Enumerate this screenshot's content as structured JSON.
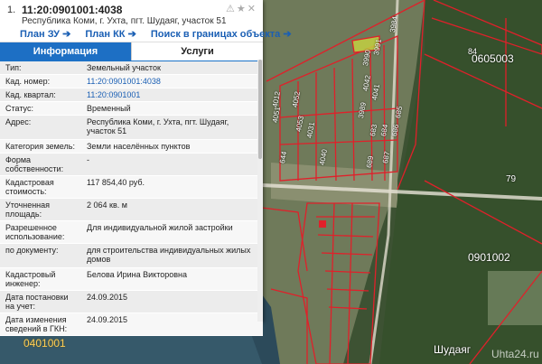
{
  "card": {
    "index": "1.",
    "title": "11:20:0901001:4038",
    "address": "Республика Коми, г. Ухта, пгт. Шудаяг, участок 51",
    "tools": "⚠★✕",
    "links": [
      "План ЗУ ➔",
      "План КК ➔",
      "Поиск в границах объекта ➔"
    ]
  },
  "tabs": {
    "info": "Информация",
    "services": "Услуги"
  },
  "rows": [
    {
      "key": "Тип:",
      "value": "Земельный участок"
    },
    {
      "key": "Кад. номер:",
      "value": "11:20:0901001:4038"
    },
    {
      "key": "Кад. квартал:",
      "value": "11:20:0901001"
    },
    {
      "key": "Статус:",
      "value": "Временный"
    },
    {
      "key": "Адрес:",
      "value": "Республика Коми, г. Ухта, пгт. Шудаяг, участок 51"
    },
    {
      "key": "Категория земель:",
      "value": "Земли населённых пунктов"
    },
    {
      "key": "Форма собственности:",
      "value": "-"
    },
    {
      "key": "Кадастровая стоимость:",
      "value": "117 854,40 руб."
    },
    {
      "key": "Уточненная площадь:",
      "value": "2 064 кв. м"
    },
    {
      "key": "Разрешенное использование:",
      "value": "Для индивидуальной жилой застройки"
    },
    {
      "key": "по документу:",
      "value": "для строительства индивидуальных жилых домов"
    },
    {
      "key": "Кадастровый инженер:",
      "value": "Белова Ирина Викторовна"
    },
    {
      "key": "Дата постановки на учет:",
      "value": "24.09.2015"
    },
    {
      "key": "Дата изменения сведений в ГКН:",
      "value": "24.09.2015"
    }
  ],
  "map": {
    "labels": [
      "84",
      "0605003",
      "79",
      "0901002",
      "0401001",
      "Шудаяг"
    ],
    "parcels": [
      "4012",
      "4051",
      "4052",
      "4053",
      "4031",
      "4042",
      "4041",
      "3989",
      "3990",
      "3991",
      "3984",
      "683",
      "684",
      "689",
      "687",
      "686",
      "685",
      "644",
      "4040"
    ],
    "watermark": "Uhta24.ru"
  }
}
